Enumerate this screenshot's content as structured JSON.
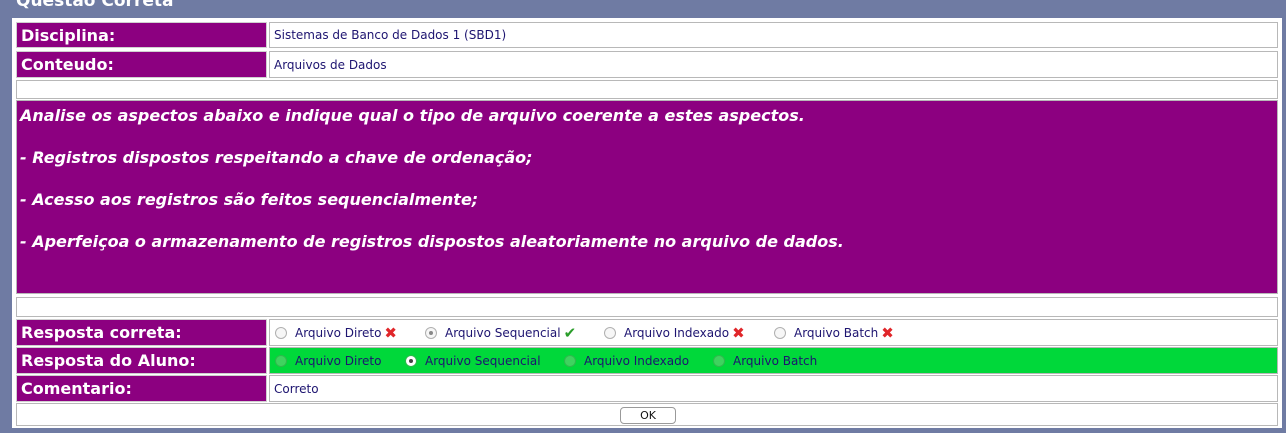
{
  "legend_title": "Questão Correta",
  "disciplina": {
    "label": "Disciplina:",
    "value": "Sistemas de Banco de Dados 1 (SBD1)"
  },
  "conteudo": {
    "label": "Conteudo:",
    "value": "Arquivos de Dados"
  },
  "question": {
    "lines": [
      "Analise os aspectos abaixo e indique qual o tipo de arquivo coerente a estes aspectos.",
      "- Registros dispostos respeitando a chave de ordenação;",
      "- Acesso aos registros são feitos sequencialmente;",
      "- Aperfeiçoa o armazenamento de registros dispostos aleatoriamente no arquivo de dados."
    ]
  },
  "resposta_correta": {
    "label": "Resposta correta:",
    "options": [
      {
        "label": "Arquivo Direto",
        "selected": false,
        "mark": "cross"
      },
      {
        "label": "Arquivo Sequencial",
        "selected": true,
        "mark": "check"
      },
      {
        "label": "Arquivo Indexado",
        "selected": false,
        "mark": "cross"
      },
      {
        "label": "Arquivo Batch",
        "selected": false,
        "mark": "cross"
      }
    ]
  },
  "resposta_aluno": {
    "label": "Resposta do Aluno:",
    "options": [
      {
        "label": "Arquivo Direto",
        "selected": false
      },
      {
        "label": "Arquivo Sequencial",
        "selected": true
      },
      {
        "label": "Arquivo Indexado",
        "selected": false
      },
      {
        "label": "Arquivo Batch",
        "selected": false
      }
    ]
  },
  "comentario": {
    "label": "Comentario:",
    "value": "Correto"
  },
  "ok_button": {
    "label": "OK"
  },
  "colors": {
    "label_bg": "#8c0080",
    "aluno_bg": "#00d83a",
    "background": "#6f7ba3"
  }
}
